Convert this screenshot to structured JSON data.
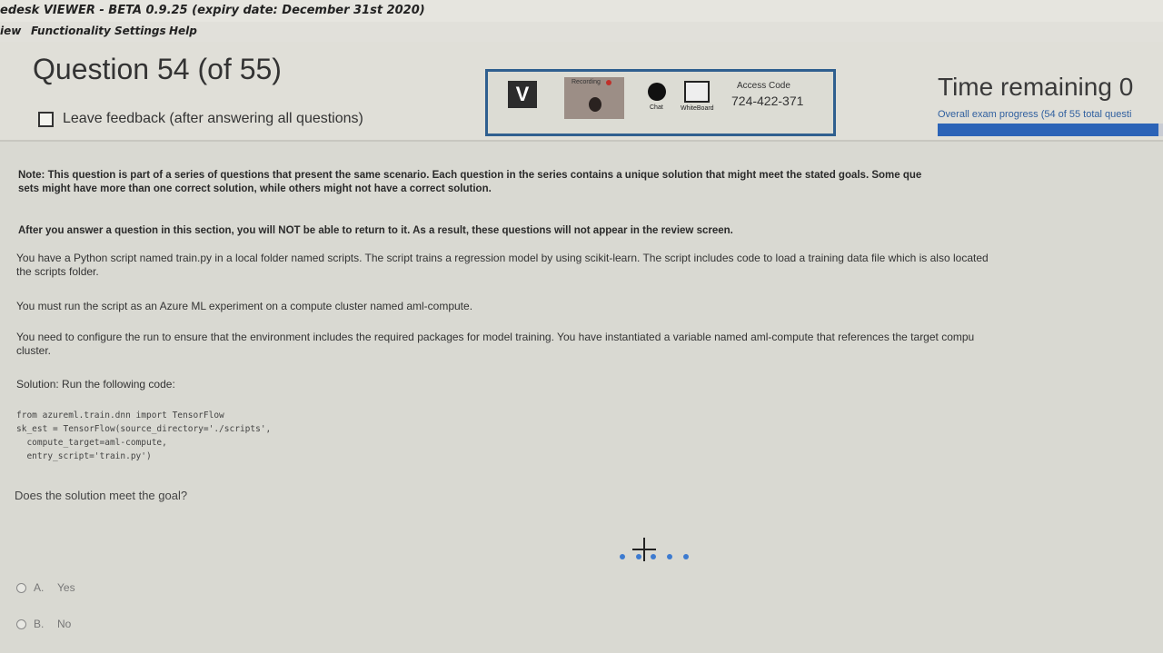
{
  "app": {
    "title": "edesk VIEWER - BETA 0.9.25 (expiry date: December 31st 2020)"
  },
  "menu": [
    "iew",
    "Functionality",
    "Settings",
    "Help"
  ],
  "header": {
    "question_title": "Question 54 (of 55)",
    "feedback_label": "Leave feedback (after answering all questions)",
    "proctor": {
      "logo": "V",
      "recording_label": "Recording",
      "chat_label": "Chat",
      "whiteboard_label": "WhiteBoard",
      "access_code_label": "Access Code",
      "access_code": "724-422-371"
    },
    "time_remaining_label": "Time remaining 0",
    "progress_label": "Overall exam progress (54 of 55 total questi",
    "progress_fraction": 0.98
  },
  "content": {
    "note_line1": "Note: This question is part of a series of questions that present the same scenario. Each question in the series contains a unique solution that might meet the stated goals. Some que",
    "note_line2": "sets might have more than one correct solution, while others might not have a correct solution.",
    "warning": "After you answer a question in this section, you will NOT be able to return to it. As a result, these questions will not appear in the review screen.",
    "para1_line1": "You have a Python script named train.py in a local folder named scripts. The script trains a regression model by using scikit-learn. The script includes code to load a training data file which is also located",
    "para1_line2": "the scripts folder.",
    "para2": "You must run the script as an Azure ML experiment on a compute cluster named aml-compute.",
    "para3_line1": "You need to configure the run to ensure that the environment includes the required packages for model training. You have instantiated a variable named aml-compute that references the target compu",
    "para3_line2": "cluster.",
    "solution": "Solution: Run the following code:",
    "code": [
      "from azureml.train.dnn import TensorFlow",
      "sk_est = TensorFlow(source_directory='./scripts',",
      "  compute_target=aml-compute,",
      "  entry_script='train.py')"
    ],
    "goal_question": "Does the solution meet the goal?",
    "options": [
      {
        "key": "A.",
        "label": "Yes"
      },
      {
        "key": "B.",
        "label": "No"
      }
    ]
  },
  "colors": {
    "accent": "#2b63b7",
    "proctor_border": "#2f5f8f"
  }
}
